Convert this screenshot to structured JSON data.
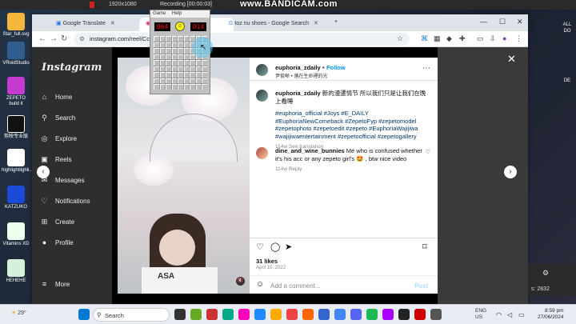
{
  "screen": {
    "top_bar": {
      "resolution": "1920x1080",
      "recording": "Recording [00:00:03]",
      "watermark": "www.BANDICAM.com"
    }
  },
  "desktop": {
    "icons": [
      "Star_full.svg",
      "VRoidStudio",
      "ZEPETO build it",
      "剪映专业版",
      "highlightlighli...",
      "KATZUKO",
      "Vitamins XD",
      "HEHEHE"
    ],
    "right_labels": [
      "ALL",
      "DO",
      "DE"
    ]
  },
  "browser": {
    "tabs": [
      {
        "label": "Google Translate"
      },
      {
        "label": ""
      },
      {
        "label": "toz nu shoes - Google Search"
      }
    ],
    "url": "instagram.com/reel/CcWi",
    "window_buttons": [
      "—",
      "☐",
      "✕"
    ]
  },
  "instagram": {
    "logo": "Instagram",
    "nav": [
      "Home",
      "Search",
      "Explore",
      "Reels",
      "Messages",
      "Notifications",
      "Create",
      "Profile",
      "More"
    ],
    "post": {
      "username": "euphoria_zdaily",
      "follow": "Follow",
      "subtitle": "尹俊晰 • 落在生命裡的光",
      "caption_text": "新的漫遷情节 所以我们只是让我们在晚上看睡",
      "tags": "#euphoria_official #Joys #E_DAILY #EuphoriaNewComeback #ZepetoFyp #zepetomodel #zepetophoto #zepetoedit #zepeto #EuphoriaWajijiwa #wajijiwaentertainment #zepetoofficial #zepetogallery",
      "caption_meta": "114w  See translation",
      "comment_user": "dine_and_wine_bunnies",
      "comment_text": "Me who is confused whether it's his acc or any zepeto girl's 🤩 , btw nice video",
      "comment_meta": "114w  Reply",
      "likes": "31 likes",
      "date": "April 15, 2022",
      "add_comment": "Add a comment...",
      "post_btn": "Post"
    },
    "image_text": "ASA"
  },
  "minesweeper": {
    "menu": [
      "Game",
      "Help"
    ],
    "mines_left": "064",
    "time": "014"
  },
  "side_panel": {
    "label": "s: 2832"
  },
  "taskbar": {
    "weather": "29°",
    "search": "Search",
    "lang": "ENG",
    "region": "US",
    "time": "8:59 pm",
    "date": "27/06/2024"
  }
}
